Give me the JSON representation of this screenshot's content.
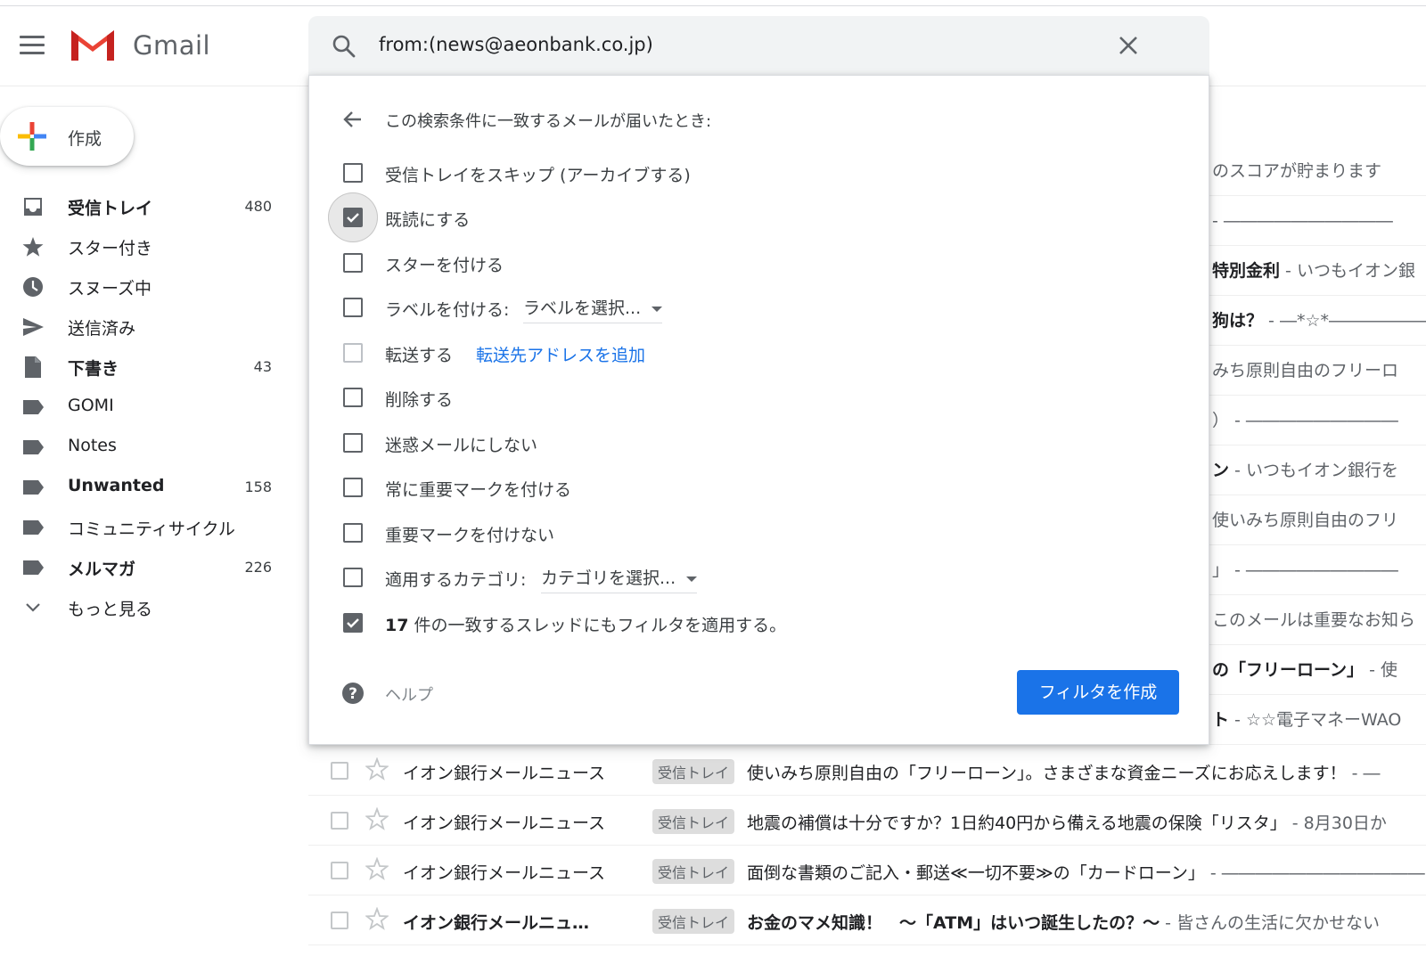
{
  "app": {
    "brand": "Gmail"
  },
  "search": {
    "query": "from:(news@aeonbank.co.jp)"
  },
  "compose": {
    "label": "作成"
  },
  "sidebar": {
    "items": [
      {
        "label": "受信トレイ",
        "count": "480",
        "bold": true,
        "icon": "inbox-icon"
      },
      {
        "label": "スター付き",
        "count": "",
        "bold": false,
        "icon": "star-icon"
      },
      {
        "label": "スヌーズ中",
        "count": "",
        "bold": false,
        "icon": "clock-icon"
      },
      {
        "label": "送信済み",
        "count": "",
        "bold": false,
        "icon": "send-icon"
      },
      {
        "label": "下書き",
        "count": "43",
        "bold": true,
        "icon": "draft-icon"
      },
      {
        "label": "GOMI",
        "count": "",
        "bold": false,
        "icon": "label-icon"
      },
      {
        "label": "Notes",
        "count": "",
        "bold": false,
        "icon": "label-icon"
      },
      {
        "label": "Unwanted",
        "count": "158",
        "bold": true,
        "icon": "label-icon"
      },
      {
        "label": "コミュニティサイクル",
        "count": "",
        "bold": false,
        "icon": "label-icon"
      },
      {
        "label": "メルマガ",
        "count": "226",
        "bold": true,
        "icon": "label-icon"
      },
      {
        "label": "もっと見る",
        "count": "",
        "bold": false,
        "icon": "chevron-down-icon"
      }
    ]
  },
  "filter": {
    "title": "この検索条件に一致するメールが届いたとき:",
    "options": {
      "skip_inbox": "受信トレイをスキップ (アーカイブする)",
      "mark_read": "既読にする",
      "star": "スターを付ける",
      "apply_label": "ラベルを付ける:",
      "label_select": "ラベルを選択...",
      "forward": "転送する",
      "forward_link": "転送先アドレスを追加",
      "delete": "削除する",
      "never_spam": "迷惑メールにしない",
      "always_important": "常に重要マークを付ける",
      "never_important": "重要マークを付けない",
      "category": "適用するカテゴリ:",
      "category_select": "カテゴリを選択...",
      "apply_count": "17",
      "apply_existing": "件の一致するスレッドにもフィルタを適用する。"
    },
    "help": "ヘルプ",
    "create_button": "フィルタを作成"
  },
  "bg_rows": [
    {
      "bold": "",
      "text": "のスコアが貯まります"
    },
    {
      "bold": "",
      "text": "- ――――――――――"
    },
    {
      "bold": "特別金利",
      "text": " - いつもイオン銀"
    },
    {
      "bold": "狗は？",
      "text": " - ―*☆*――――――"
    },
    {
      "bold": "",
      "text": "みち原則自由のフリーロ"
    },
    {
      "bold": "",
      "text": "） - ―――――――――"
    },
    {
      "bold": "ン",
      "text": " - いつもイオン銀行を"
    },
    {
      "bold": "",
      "text": "使いみち原則自由のフリ"
    },
    {
      "bold": "",
      "text": "」 - ―――――――――"
    },
    {
      "bold": "",
      "text": "このメールは重要なお知ら"
    },
    {
      "bold": "の「フリーローン」",
      "text": " - 使"
    },
    {
      "bold": "ト",
      "text": " - ☆☆電子マネーWAO"
    }
  ],
  "mails": [
    {
      "sender": "イオン銀行メールニュース",
      "tag": "受信トレイ",
      "subject": "使いみち原則自由の「フリーローン」。さまざまな資金ニーズにお応えします！",
      "snippet": " - ―",
      "unread": false
    },
    {
      "sender": "イオン銀行メールニュース",
      "tag": "受信トレイ",
      "subject": "地震の補償は十分ですか？1日約40円から備える地震の保険「リスタ」",
      "snippet": " - 8月30日か",
      "unread": false
    },
    {
      "sender": "イオン銀行メールニュース",
      "tag": "受信トレイ",
      "subject": "面倒な書類のご記入・郵送≪一切不要≫の「カードローン」",
      "snippet": " - ――――――――――――",
      "unread": false
    },
    {
      "sender": "イオン銀行メールニュ…",
      "tag": "受信トレイ",
      "subject": "お金のマメ知識！　～「ATM」はいつ誕生したの？～",
      "snippet": " - 皆さんの生活に欠かせない",
      "unread": true
    }
  ],
  "colors": {
    "accent": "#1a73e8",
    "gmail_red": "#ea4335",
    "icon_gray": "#5f6368"
  }
}
